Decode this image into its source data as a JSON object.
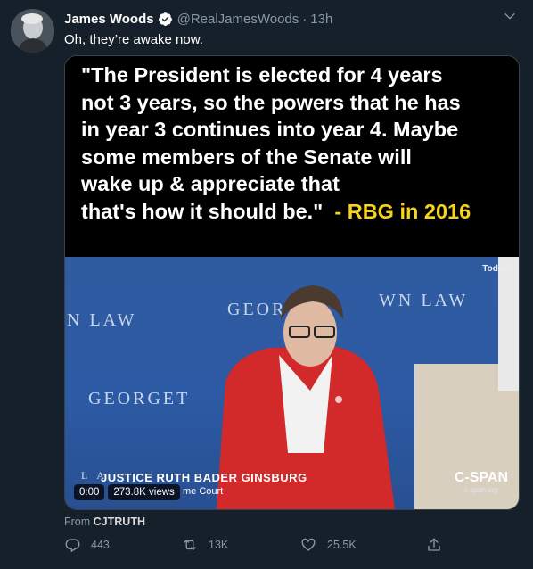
{
  "tweet": {
    "author_name": "James Woods",
    "handle": "@RealJamesWoods",
    "separator": "·",
    "time": "13h",
    "text": "Oh, they’re awake now.",
    "verified_icon": "verified-badge-icon",
    "caret_icon": "chevron-down-icon"
  },
  "media": {
    "quote_lines": [
      "\"The President is elected for 4 years",
      "not 3 years, so the powers that he has",
      "in year 3 continues into year 4. Maybe",
      "some members of the Senate will",
      "wake up & appreciate that"
    ],
    "quote_last_line": "that's how it should be.\"",
    "quote_attribution": "- RBG in 2016",
    "video": {
      "backdrop_left": "N LAW",
      "backdrop_center": "GEOR",
      "backdrop_right": "WN LAW",
      "backdrop_lower": "GEORGET",
      "backdrop_edge": "OR",
      "network_label": "Today",
      "lower_third_name": "JUSTICE RUTH BADER GINSBURG",
      "lower_third_title": "me Court",
      "lower_third_prefix": "L A",
      "logo": "C-SPAN",
      "logo_url": "c-span.org",
      "elapsed": "0:00",
      "views": "273.8K views"
    }
  },
  "source": {
    "prefix": "From",
    "name": "CJTRUTH"
  },
  "actions": {
    "reply_count": "443",
    "retweet_count": "13K",
    "like_count": "25.5K"
  },
  "colors": {
    "background": "#15202b",
    "secondary_text": "#8899a6",
    "attribution_yellow": "#f7d31d",
    "verified_blue": "#1da1f2"
  }
}
